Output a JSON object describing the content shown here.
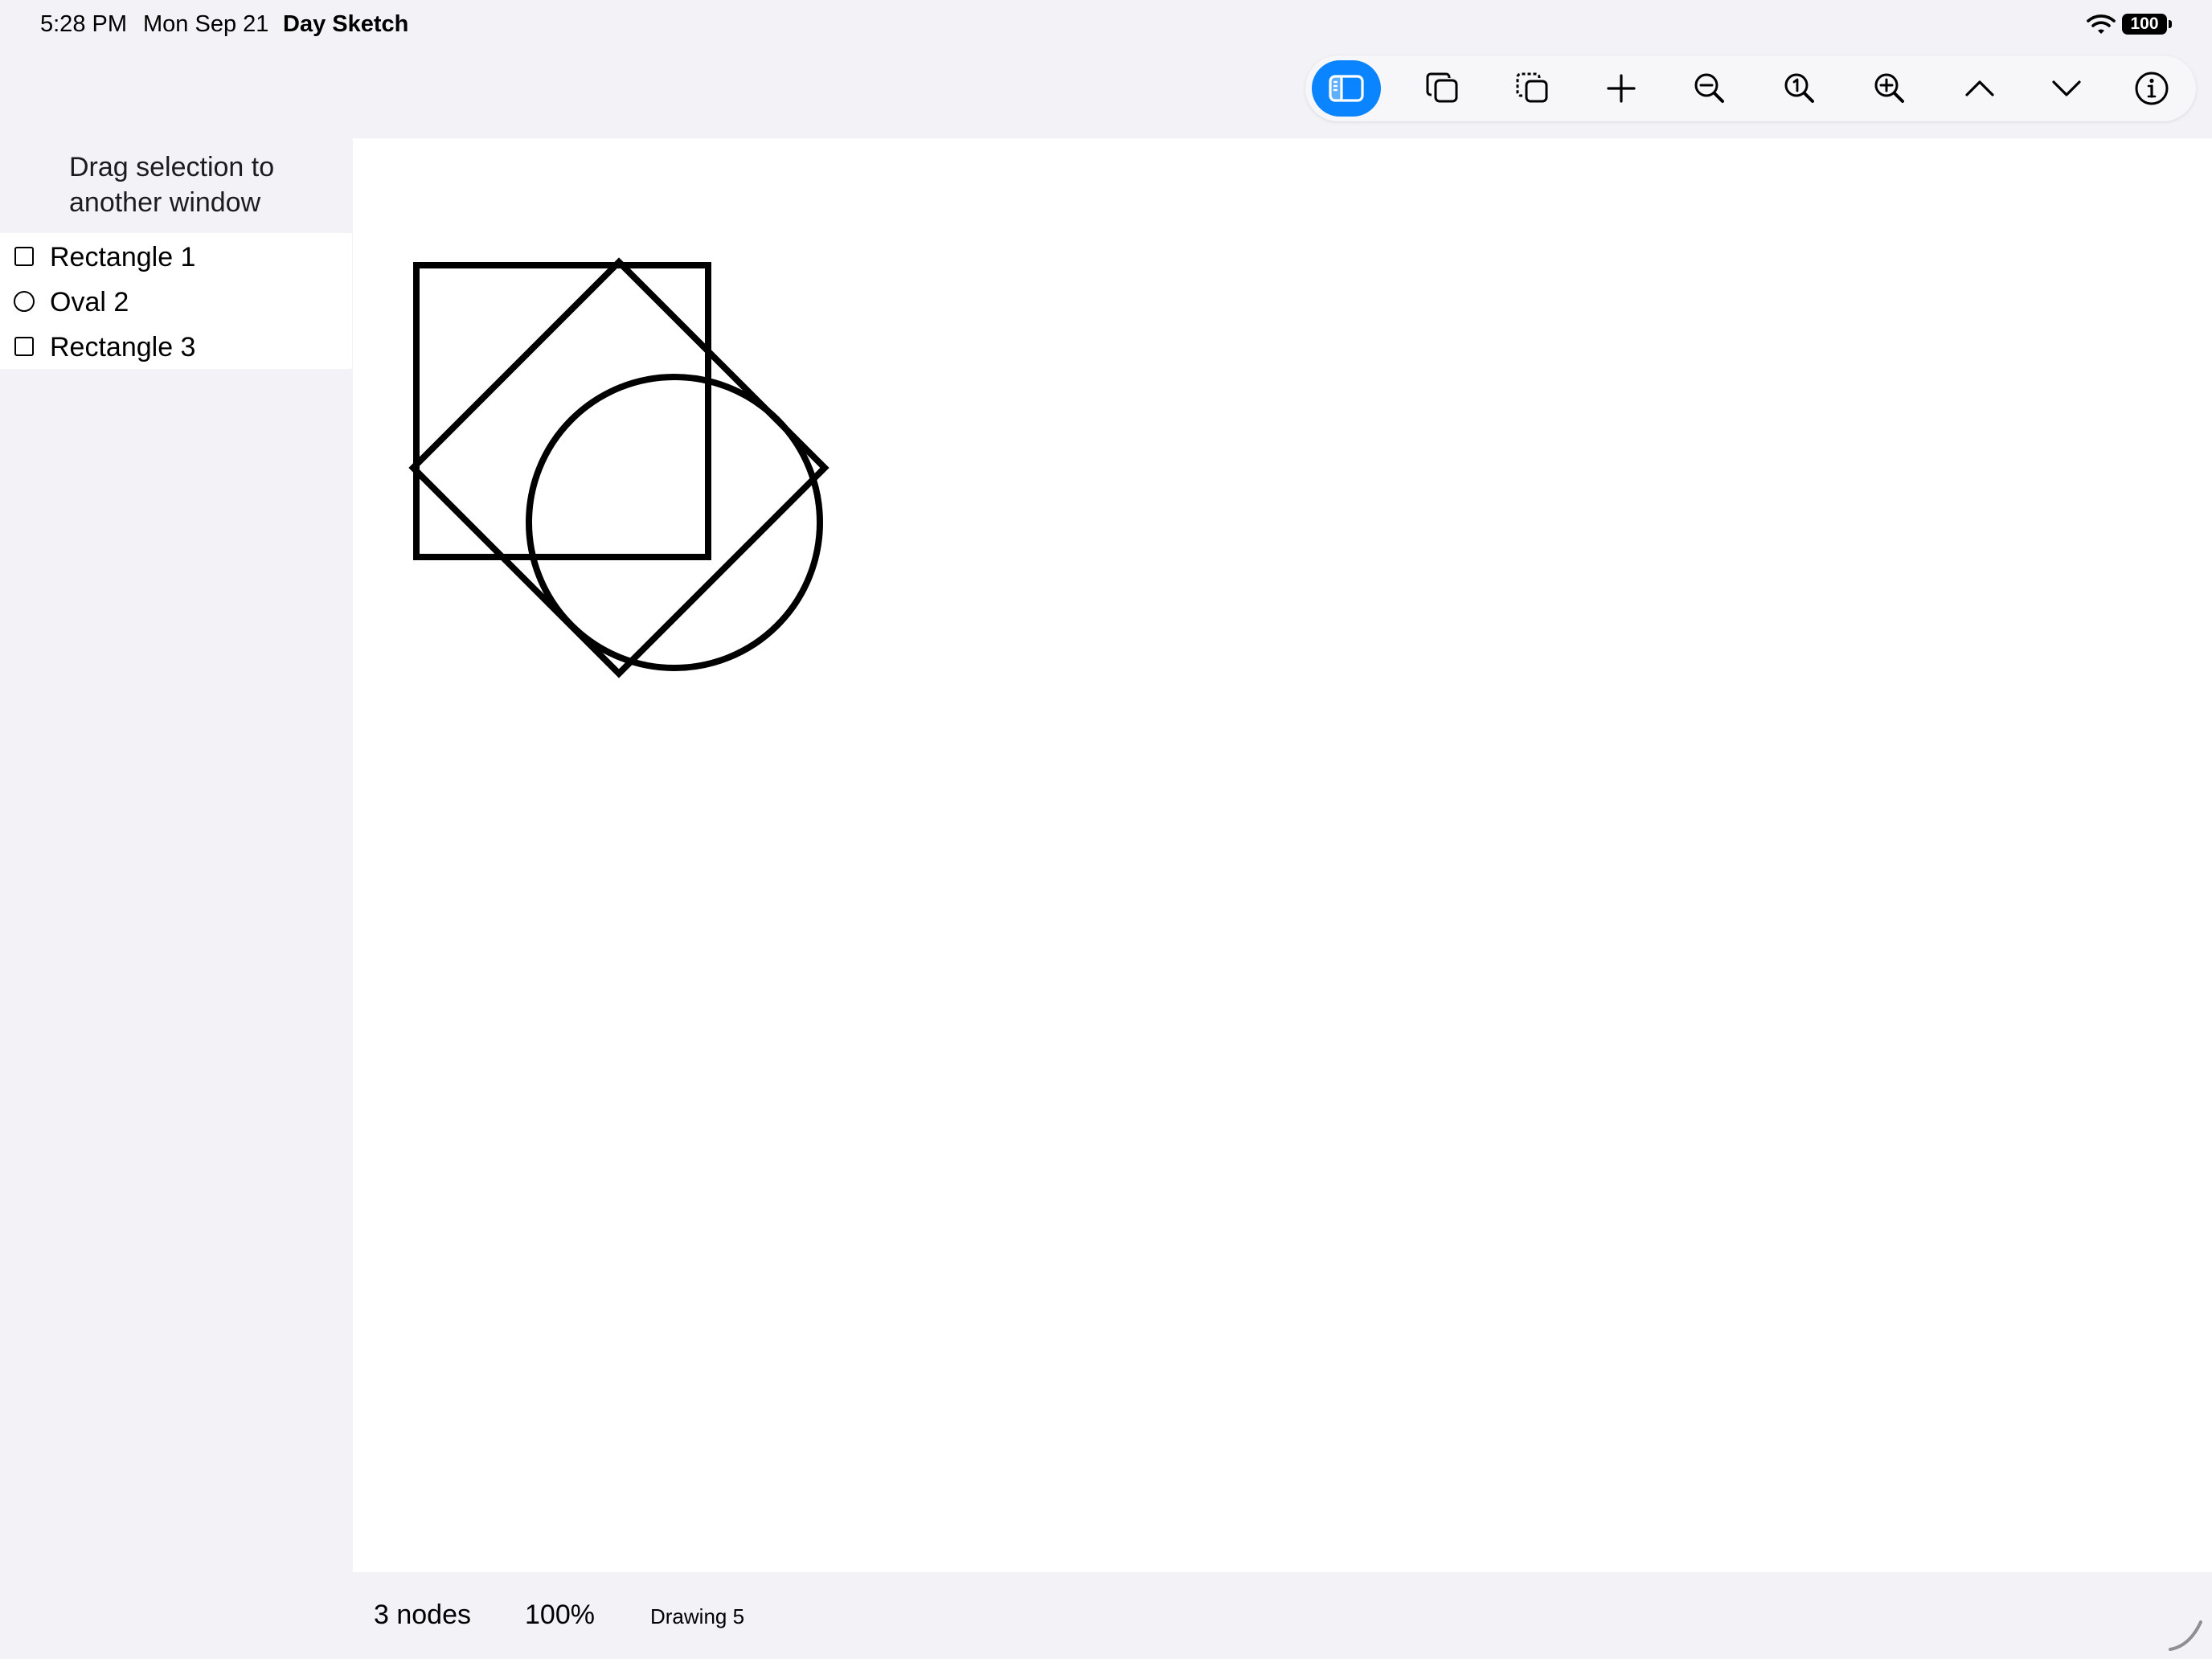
{
  "status_bar": {
    "time": "5:28 PM",
    "date": "Mon Sep 21",
    "app_name": "Day Sketch",
    "battery": "100"
  },
  "toolbar": {
    "buttons": [
      {
        "name": "sidebar-toggle",
        "icon": "sidebar-icon",
        "active": true
      },
      {
        "name": "duplicate",
        "icon": "duplicate-icon"
      },
      {
        "name": "copy-selection",
        "icon": "dashed-copy-icon"
      },
      {
        "name": "add",
        "icon": "plus-icon"
      },
      {
        "name": "zoom-out",
        "icon": "zoom-out-icon"
      },
      {
        "name": "actual-size",
        "icon": "zoom-actual-size-icon"
      },
      {
        "name": "zoom-in",
        "icon": "zoom-in-icon"
      },
      {
        "name": "move-up",
        "icon": "chevron-up-icon"
      },
      {
        "name": "move-down",
        "icon": "chevron-down-icon"
      },
      {
        "name": "info",
        "icon": "info-icon"
      }
    ],
    "accent_color": "#0a84ff"
  },
  "sidebar": {
    "header": "Drag selection to another window",
    "items": [
      {
        "label": "Rectangle 1",
        "icon": "rectangle-icon"
      },
      {
        "label": "Oval 2",
        "icon": "oval-icon"
      },
      {
        "label": "Rectangle 3",
        "icon": "rectangle-icon"
      }
    ]
  },
  "canvas": {
    "shapes": [
      {
        "name": "Rectangle 1",
        "type": "rectangle"
      },
      {
        "name": "Oval 2",
        "type": "oval"
      },
      {
        "name": "Rectangle 3",
        "type": "rectangle",
        "rotation_deg": 45
      }
    ]
  },
  "footer": {
    "node_count": "3 nodes",
    "zoom": "100%",
    "document_name": "Drawing 5"
  }
}
